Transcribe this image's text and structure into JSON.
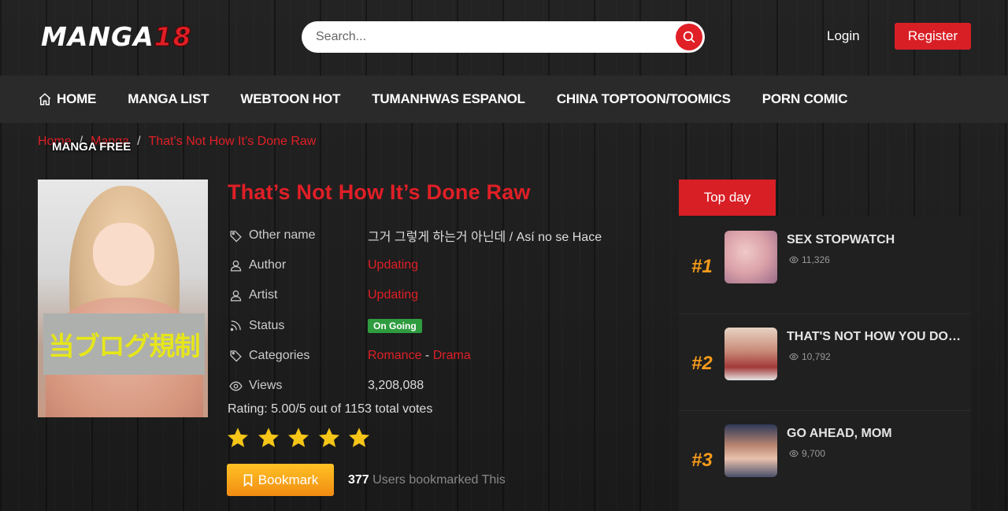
{
  "header": {
    "logo_text": "MANGA",
    "logo_number": "18",
    "search_placeholder": "Search...",
    "login_label": "Login",
    "register_label": "Register"
  },
  "nav": {
    "items": [
      {
        "label": "HOME"
      },
      {
        "label": "MANGA LIST"
      },
      {
        "label": "WEBTOON HOT"
      },
      {
        "label": "TUMANHWAS ESPANOL"
      },
      {
        "label": "CHINA TOPTOON/TOOMICS"
      },
      {
        "label": "PORN COMIC"
      }
    ]
  },
  "breadcrumb": {
    "home": "Home",
    "manga": "Manga",
    "current": "That’s Not How It’s Done Raw",
    "separator": "/",
    "overlay_label": "MANGA FREE"
  },
  "cover": {
    "censor_text": "当ブログ規制"
  },
  "manga": {
    "title": "That’s Not How It’s Done Raw",
    "other_name_label": "Other name",
    "other_name": "그거 그렇게 하는거 아닌데 / Así no se Hace",
    "author_label": "Author",
    "author": "Updating",
    "artist_label": "Artist",
    "artist": "Updating",
    "status_label": "Status",
    "status": "On Going",
    "categories_label": "Categories",
    "category_1": "Romance",
    "category_sep": " - ",
    "category_2": "Drama",
    "views_label": "Views",
    "views": "3,208,088",
    "rating_text": "Rating: 5.00/5 out of 1153 total votes",
    "stars": 5,
    "bookmark_label": "Bookmark",
    "bookmark_count": "377",
    "bookmark_suffix": " Users bookmarked This"
  },
  "top_day": {
    "tab_label": "Top day",
    "items": [
      {
        "rank": "#1",
        "name": "SEX STOPWATCH",
        "views": "11,326"
      },
      {
        "rank": "#2",
        "name": "THAT'S NOT HOW YOU DO IT",
        "views": "10,792"
      },
      {
        "rank": "#3",
        "name": "GO AHEAD, MOM",
        "views": "9,700"
      }
    ]
  },
  "colors": {
    "accent": "#e01f26",
    "status_green": "#2e9c3f",
    "star_yellow": "#f5c518",
    "rank_orange": "#f59a1a"
  }
}
